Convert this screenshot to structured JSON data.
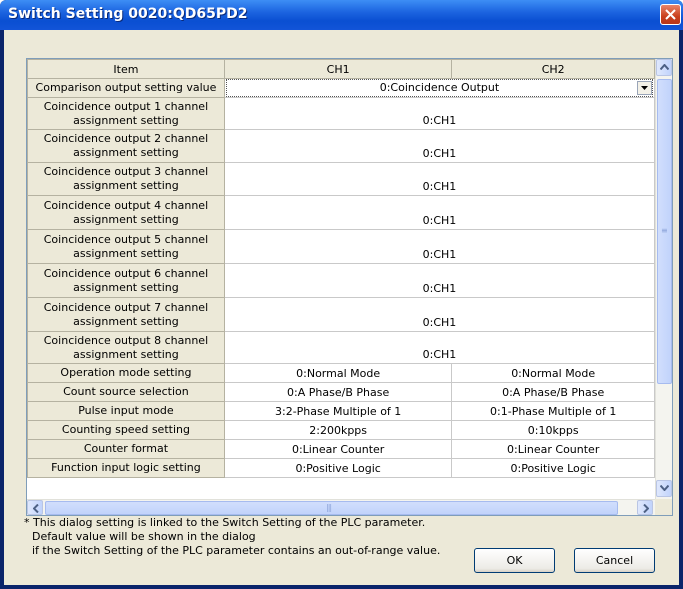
{
  "window": {
    "title": "Switch Setting 0020:QD65PD2"
  },
  "grid": {
    "headers": {
      "item": "Item",
      "ch1": "CH1",
      "ch2": "CH2"
    },
    "comparison": {
      "label": "Comparison output setting value",
      "value": "0:Coincidence Output"
    },
    "coincidence_rows": [
      {
        "label_line1": "Coincidence output 1 channel",
        "label_line2": "assignment setting",
        "value": "0:CH1"
      },
      {
        "label_line1": "Coincidence output 2 channel",
        "label_line2": "assignment setting",
        "value": "0:CH1"
      },
      {
        "label_line1": "Coincidence output 3 channel",
        "label_line2": "assignment setting",
        "value": "0:CH1"
      },
      {
        "label_line1": "Coincidence output 4 channel",
        "label_line2": "assignment setting",
        "value": "0:CH1"
      },
      {
        "label_line1": "Coincidence output 5 channel",
        "label_line2": "assignment setting",
        "value": "0:CH1"
      },
      {
        "label_line1": "Coincidence output 6 channel",
        "label_line2": "assignment setting",
        "value": "0:CH1"
      },
      {
        "label_line1": "Coincidence output 7 channel",
        "label_line2": "assignment setting",
        "value": "0:CH1"
      },
      {
        "label_line1": "Coincidence output 8 channel",
        "label_line2": "assignment setting",
        "value": "0:CH1"
      }
    ],
    "rows": [
      {
        "label": "Operation mode setting",
        "ch1": "0:Normal Mode",
        "ch2": "0:Normal Mode"
      },
      {
        "label": "Count source selection",
        "ch1": "0:A Phase/B Phase",
        "ch2": "0:A Phase/B Phase"
      },
      {
        "label": "Pulse input mode",
        "ch1": "3:2-Phase Multiple of 1",
        "ch2": "0:1-Phase Multiple of 1"
      },
      {
        "label": "Counting speed setting",
        "ch1": "2:200kpps",
        "ch2": "0:10kpps"
      },
      {
        "label": "Counter format",
        "ch1": "0:Linear Counter",
        "ch2": "0:Linear Counter"
      },
      {
        "label": "Function input logic setting",
        "ch1": "0:Positive Logic",
        "ch2": "0:Positive Logic"
      }
    ]
  },
  "note": {
    "line1": "* This dialog setting is linked to the Switch Setting of the PLC parameter.",
    "line2": "Default value will be shown in the dialog",
    "line3": "if the Switch Setting of the PLC parameter contains an out-of-range value."
  },
  "buttons": {
    "ok": "OK",
    "cancel": "Cancel"
  },
  "colors": {
    "titlebar": "#0a4fd2",
    "dialog_face": "#ece9d8",
    "close_button": "#c9401d"
  }
}
